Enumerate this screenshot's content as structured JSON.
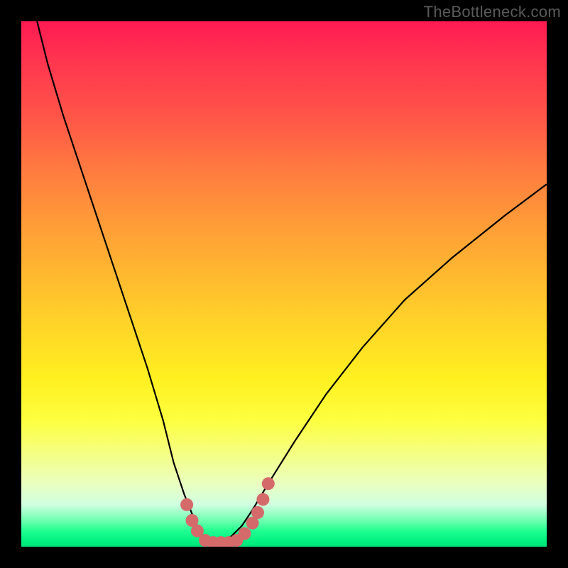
{
  "watermark": "TheBottleneck.com",
  "chart_data": {
    "type": "line",
    "title": "",
    "xlabel": "",
    "ylabel": "",
    "xlim": [
      0,
      100
    ],
    "ylim": [
      0,
      100
    ],
    "series": [
      {
        "name": "bottleneck-curve",
        "x": [
          3,
          5,
          8,
          12,
          16,
          20,
          24,
          27,
          29,
          31,
          33,
          34.5,
          36,
          38,
          40,
          42,
          44,
          47,
          52,
          58,
          65,
          73,
          82,
          92,
          100
        ],
        "y": [
          100,
          92,
          82,
          70,
          58,
          46,
          34,
          24,
          16,
          10,
          5,
          2,
          1,
          1,
          2,
          4,
          7,
          12,
          20,
          29,
          38,
          47,
          55,
          63,
          69
        ]
      }
    ],
    "markers": {
      "name": "highlight-dots",
      "color": "#d46a6a",
      "x": [
        31.5,
        32.5,
        33.5,
        35,
        36.5,
        38,
        39.5,
        41,
        42.5,
        44,
        45,
        46,
        47
      ],
      "y": [
        8,
        5,
        3,
        1.2,
        0.8,
        0.8,
        0.8,
        1.2,
        2.5,
        4.5,
        6.5,
        9,
        12
      ]
    },
    "gradient_bands": [
      {
        "pos": 0.0,
        "color": "#ff1a52"
      },
      {
        "pos": 0.5,
        "color": "#ffd528"
      },
      {
        "pos": 0.8,
        "color": "#fdff40"
      },
      {
        "pos": 0.97,
        "color": "#20ff90"
      },
      {
        "pos": 1.0,
        "color": "#00e078"
      }
    ]
  }
}
